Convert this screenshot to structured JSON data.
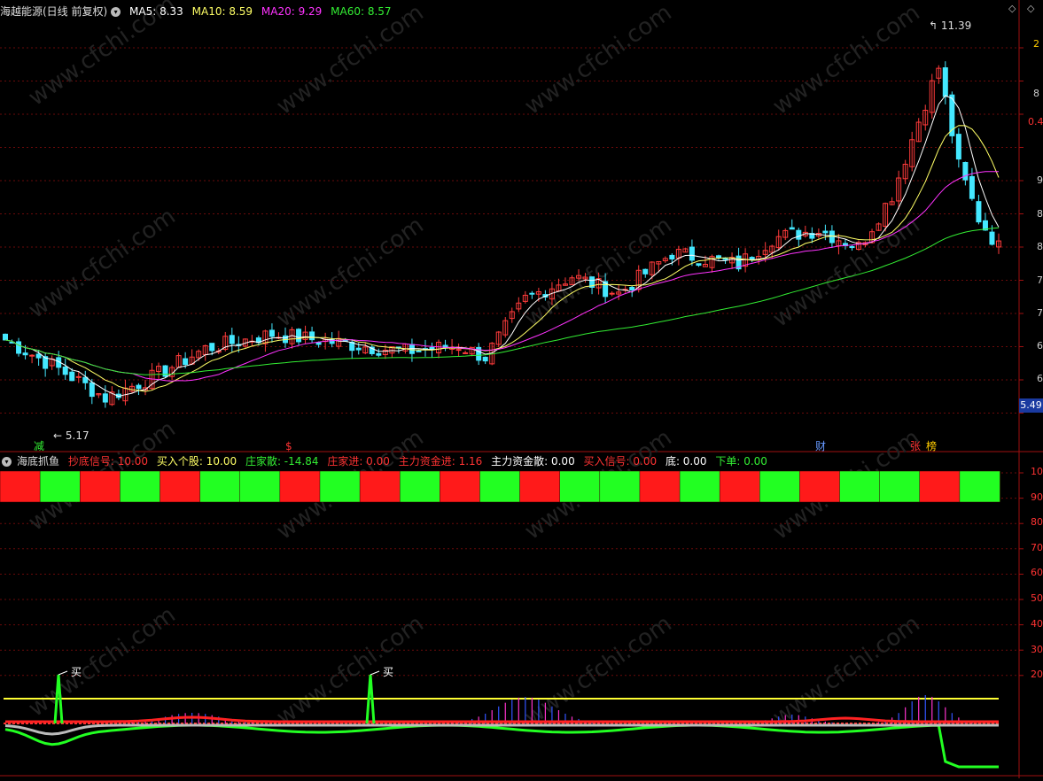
{
  "main_panel": {
    "title": "海越能源(日线 前复权)",
    "indicators": [
      {
        "label": "MA5: 8.33",
        "color": "#ffffff"
      },
      {
        "label": "MA10: 8.59",
        "color": "#ffff66"
      },
      {
        "label": "MA20: 9.29",
        "color": "#ff33ff"
      },
      {
        "label": "MA60: 8.57",
        "color": "#33ee33"
      }
    ],
    "high_label": "11.39",
    "low_label": "5.17",
    "last_price_tag": "5.49",
    "right_axis_labels": [
      "2",
      "8",
      "0.4",
      "9",
      "8",
      "8",
      "7",
      "7",
      "6",
      "6",
      "5"
    ],
    "event_tags": [
      {
        "text": "减",
        "color": "#33ee33"
      },
      {
        "text": "$",
        "color": "#ff3333"
      },
      {
        "text": "财",
        "color": "#6699ff"
      },
      {
        "text": "张",
        "color": "#ff3333"
      },
      {
        "text": "榜",
        "color": "#ffcc00"
      }
    ],
    "watermark": "www.cfchi.com"
  },
  "sub_panel": {
    "title": "海底抓鱼",
    "fields": [
      {
        "label": "抄底信号: 10.00",
        "color": "#ff3333"
      },
      {
        "label": "买入个股: 10.00",
        "color": "#ffff66"
      },
      {
        "label": "庄家散: -14.84",
        "color": "#33ee33"
      },
      {
        "label": "庄家进: 0.00",
        "color": "#ff3333"
      },
      {
        "label": "主力资金进: 1.16",
        "color": "#ff3333"
      },
      {
        "label": "主力资金散: 0.00",
        "color": "#ffffff"
      },
      {
        "label": "买入信号: 0.00",
        "color": "#ff3333"
      },
      {
        "label": "底: 0.00",
        "color": "#ffffff"
      },
      {
        "label": "下单: 0.00",
        "color": "#33ee33"
      }
    ],
    "right_axis_labels": [
      "10",
      "90",
      "80",
      "70",
      "60",
      "50",
      "40",
      "30",
      "20"
    ],
    "buy_labels": [
      "买",
      "买"
    ]
  },
  "chart_data": {
    "type": "candlestick",
    "title": "海越能源(日线 前复权)",
    "y_range": [
      4.8,
      11.8
    ],
    "high": 11.39,
    "low": 5.17,
    "last": 5.49,
    "moving_averages": {
      "MA5": 8.33,
      "MA10": 8.59,
      "MA20": 9.29,
      "MA60": 8.57
    },
    "sub_indicator": {
      "name": "海底抓鱼",
      "y_range": [
        0,
        100
      ],
      "signal_bar_colors": [
        "red",
        "green",
        "red",
        "green",
        "red",
        "green",
        "green",
        "red",
        "green",
        "red",
        "green",
        "red",
        "green",
        "red",
        "green",
        "green",
        "red",
        "green",
        "red",
        "green",
        "red",
        "green",
        "green",
        "red",
        "green"
      ],
      "values": {
        "抄底信号": 10.0,
        "买入个股": 10.0,
        "庄家散": -14.84,
        "庄家进": 0.0,
        "主力资金进": 1.16,
        "主力资金散": 0.0,
        "买入信号": 0.0,
        "底": 0.0,
        "下单": 0.0
      }
    }
  }
}
